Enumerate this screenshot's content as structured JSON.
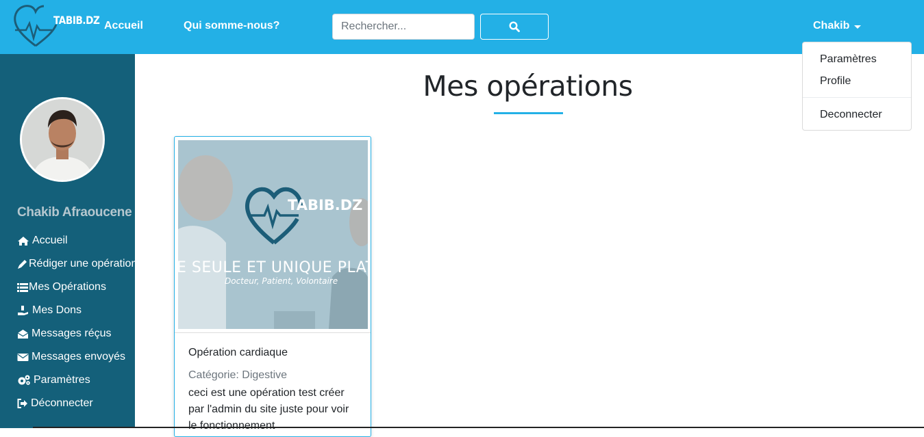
{
  "navbar": {
    "logo_text": "TABIB.DZ",
    "links": [
      "Accueil",
      "Qui somme-nous?"
    ],
    "search_placeholder": "Rechercher...",
    "user_name": "Chakib",
    "brand_color": "#23b0e6"
  },
  "dropdown": {
    "items": [
      "Paramètres",
      "Profile"
    ],
    "logout": "Deconnecter"
  },
  "sidebar": {
    "user_full_name": "Chakib Afraoucene",
    "items": [
      {
        "label": "Accueil",
        "icon": "home-icon"
      },
      {
        "label": "Rédiger une opération",
        "icon": "pencil-icon"
      },
      {
        "label": "Mes Opérations",
        "icon": "list-icon"
      },
      {
        "label": "Mes Dons",
        "icon": "donate-icon"
      },
      {
        "label": "Messages réçus",
        "icon": "envelope-open-icon"
      },
      {
        "label": "Messages envoyés",
        "icon": "envelope-icon"
      },
      {
        "label": "Paramètres",
        "icon": "gears-icon"
      },
      {
        "label": "Déconnecter",
        "icon": "sign-out-icon"
      }
    ],
    "bg_color": "#14607a"
  },
  "main": {
    "title": "Mes opérations",
    "card": {
      "image_logo_text": "TABIB.DZ",
      "image_tagline": "E SEULE ET UNIQUE PLATFO",
      "image_subtitle": "Docteur, Patient, Volontaire",
      "title": "Opération cardiaque",
      "category": "Catégorie: Digestive",
      "description": "ceci est une opération test créer par l'admin du site juste pour voir le fonctionnement"
    }
  }
}
